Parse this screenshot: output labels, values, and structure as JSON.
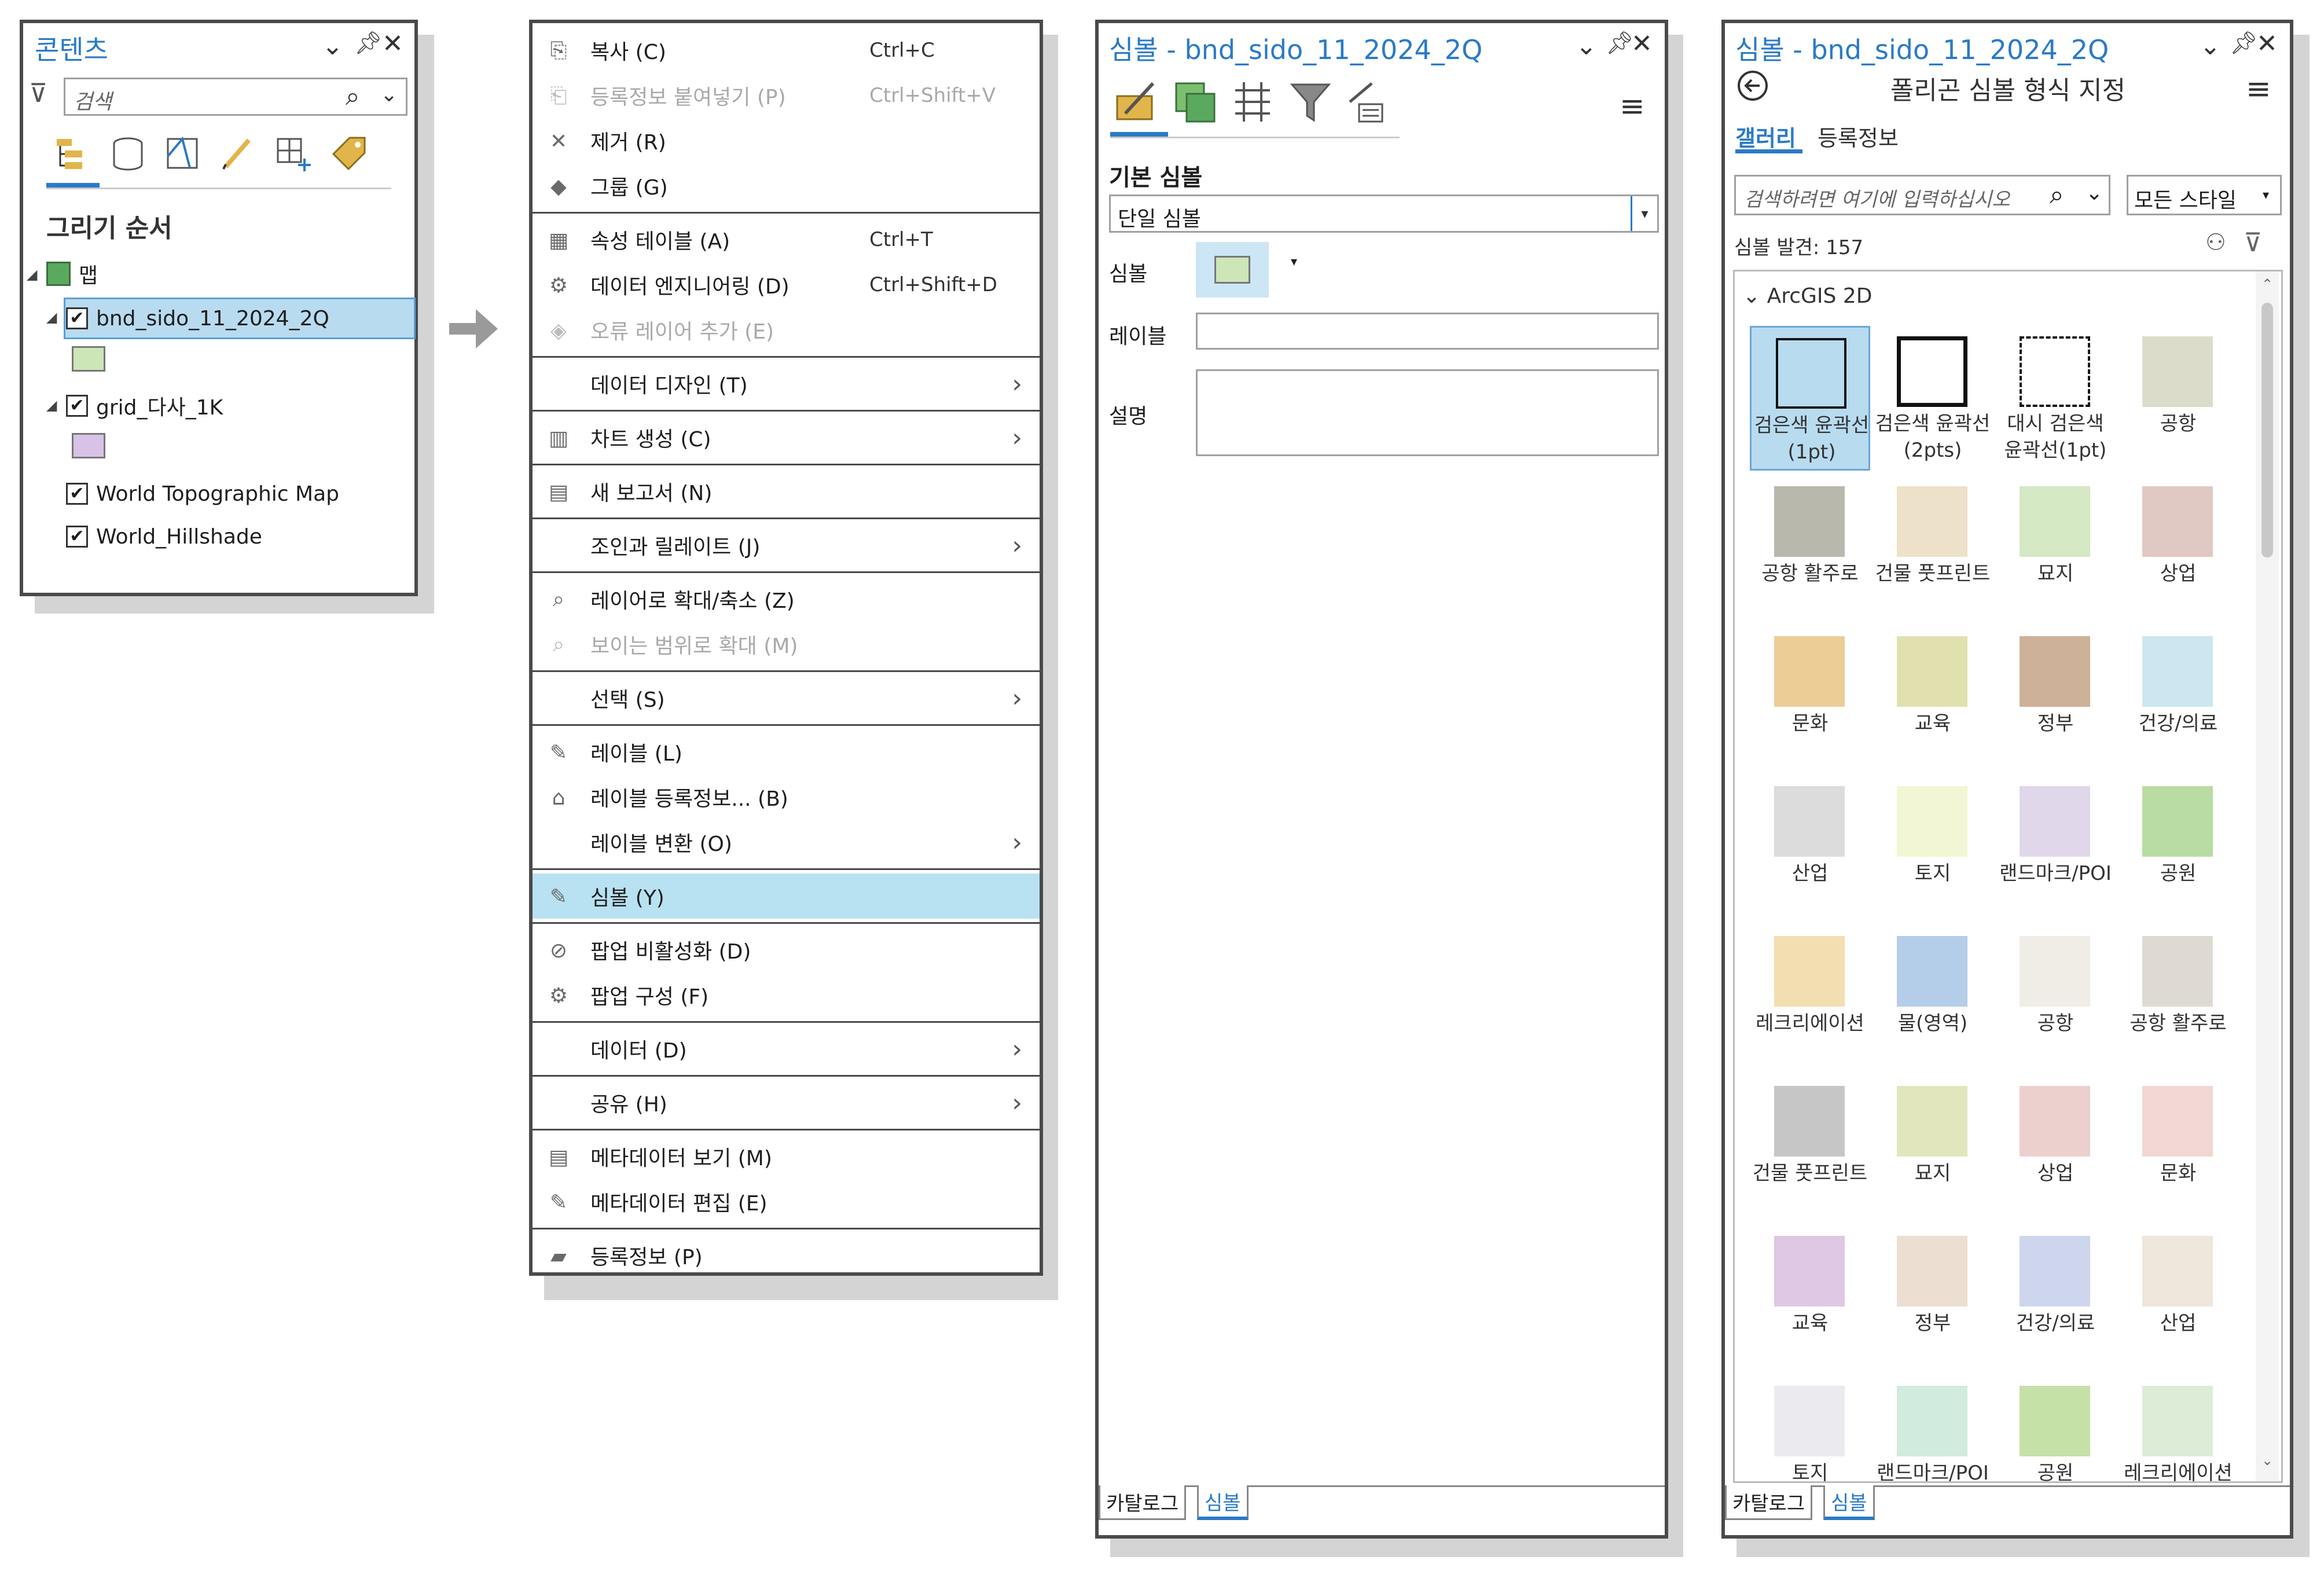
{
  "contents": {
    "title": "콘텐츠",
    "search_placeholder": "검색",
    "section_title": "그리기 순서",
    "map_label": "맵",
    "layers": [
      {
        "name": "bnd_sido_11_2024_2Q",
        "swatch": "#cce6b8"
      },
      {
        "name": "grid_다사_1K",
        "swatch": "#d8c2e8"
      }
    ],
    "basemaps": [
      "World Topographic Map",
      "World_Hillshade"
    ]
  },
  "context_menu": {
    "items": [
      {
        "label": "복사 (C)",
        "shortcut": "Ctrl+C",
        "icon": "copy-icon",
        "glyph": "⎘"
      },
      {
        "label": "등록정보 붙여넣기 (P)",
        "shortcut": "Ctrl+Shift+V",
        "icon": "paste-properties-icon",
        "glyph": "⎗",
        "disabled": true
      },
      {
        "label": "제거 (R)",
        "icon": "remove-icon",
        "glyph": "✕"
      },
      {
        "label": "그룹 (G)",
        "icon": "group-icon",
        "glyph": "◆"
      },
      {
        "label": "속성 테이블 (A)",
        "shortcut": "Ctrl+T",
        "icon": "attribute-table-icon",
        "glyph": "▦"
      },
      {
        "label": "데이터 엔지니어링 (D)",
        "shortcut": "Ctrl+Shift+D",
        "icon": "data-engineering-icon",
        "glyph": "⚙"
      },
      {
        "label": "오류 레이어 추가 (E)",
        "icon": "error-layer-icon",
        "glyph": "◈",
        "disabled": true
      },
      {
        "label": "데이터 디자인 (T)",
        "submenu": true
      },
      {
        "label": "차트 생성 (C)",
        "icon": "chart-icon",
        "glyph": "▥",
        "submenu": true
      },
      {
        "label": "새 보고서 (N)",
        "icon": "report-icon",
        "glyph": "▤"
      },
      {
        "label": "조인과 릴레이트 (J)",
        "submenu": true
      },
      {
        "label": "레이어로 확대/축소 (Z)",
        "icon": "zoom-to-layer-icon",
        "glyph": "⌕"
      },
      {
        "label": "보이는 범위로 확대 (M)",
        "icon": "zoom-visible-icon",
        "glyph": "⌕",
        "disabled": true
      },
      {
        "label": "선택 (S)",
        "submenu": true
      },
      {
        "label": "레이블 (L)",
        "icon": "label-icon",
        "glyph": "✎"
      },
      {
        "label": "레이블 등록정보... (B)",
        "icon": "label-properties-icon",
        "glyph": "⌂"
      },
      {
        "label": "레이블 변환 (O)",
        "submenu": true
      },
      {
        "label": "심볼 (Y)",
        "icon": "symbology-icon",
        "glyph": "✎",
        "selected": true
      },
      {
        "label": "팝업 비활성화 (D)",
        "icon": "disable-popup-icon",
        "glyph": "⊘"
      },
      {
        "label": "팝업 구성 (F)",
        "icon": "configure-popup-icon",
        "glyph": "⚙"
      },
      {
        "label": "데이터 (D)",
        "submenu": true
      },
      {
        "label": "공유 (H)",
        "submenu": true
      },
      {
        "label": "메타데이터 보기 (M)",
        "icon": "view-metadata-icon",
        "glyph": "▤"
      },
      {
        "label": "메타데이터 편집 (E)",
        "icon": "edit-metadata-icon",
        "glyph": "✎"
      },
      {
        "label": "등록정보 (P)",
        "icon": "properties-icon",
        "glyph": "▰"
      }
    ]
  },
  "symbology": {
    "title": "심볼 - bnd_sido_11_2024_2Q",
    "primary_label": "기본 심볼",
    "method": "단일 심볼",
    "symbol_label": "심볼",
    "symbol_color": "#cce6b8",
    "label_label": "레이블",
    "description_label": "설명",
    "bottom_tabs": [
      "카탈로그",
      "심볼"
    ]
  },
  "format": {
    "title": "심볼 - bnd_sido_11_2024_2Q",
    "subtitle": "폴리곤 심볼 형식 지정",
    "tabs": [
      "갤러리",
      "등록정보"
    ],
    "search_placeholder": "검색하려면 여기에 입력하십시오",
    "style_select": "모든 스타일",
    "found": "심볼 발견: 157",
    "group": "ArcGIS 2D",
    "bottom_tabs": [
      "카탈로그",
      "심볼"
    ],
    "gallery": [
      {
        "name": "검은색 윤곽선(1pt)",
        "fill": "transparent",
        "stroke": "thin"
      },
      {
        "name": "검은색 윤곽선(2pts)",
        "fill": "transparent",
        "stroke": "thick"
      },
      {
        "name": "대시 검은색 윤곽선(1pt)",
        "fill": "transparent",
        "stroke": "dash"
      },
      {
        "name": "공항",
        "fill": "#dcdccb"
      },
      {
        "name": "공항 활주로",
        "fill": "#b8b8ad"
      },
      {
        "name": "건물 풋프린트",
        "fill": "#ede1c9"
      },
      {
        "name": "묘지",
        "fill": "#d3e8c3"
      },
      {
        "name": "상업",
        "fill": "#e1c9c3"
      },
      {
        "name": "문화",
        "fill": "#eccd95"
      },
      {
        "name": "교육",
        "fill": "#e0e1ae"
      },
      {
        "name": "정부",
        "fill": "#cdb198"
      },
      {
        "name": "건강/의료",
        "fill": "#cde6ef"
      },
      {
        "name": "산업",
        "fill": "#dcdcdc"
      },
      {
        "name": "토지",
        "fill": "#f2f6d5"
      },
      {
        "name": "랜드마크/POI",
        "fill": "#e1d7ea"
      },
      {
        "name": "공원",
        "fill": "#b9dca3"
      },
      {
        "name": "레크리에이션",
        "fill": "#f3deb1"
      },
      {
        "name": "물(영역)",
        "fill": "#b4cde9"
      },
      {
        "name": "공항",
        "fill": "#efede5"
      },
      {
        "name": "공항 활주로",
        "fill": "#dedad2"
      },
      {
        "name": "건물 풋프린트",
        "fill": "#c6c6c6"
      },
      {
        "name": "묘지",
        "fill": "#e2e6bd"
      },
      {
        "name": "상업",
        "fill": "#ecd0cd"
      },
      {
        "name": "문화",
        "fill": "#f1d6d3"
      },
      {
        "name": "교육",
        "fill": "#dec8e3"
      },
      {
        "name": "정부",
        "fill": "#ecdfd1"
      },
      {
        "name": "건강/의료",
        "fill": "#ced6ee"
      },
      {
        "name": "산업",
        "fill": "#efe6dc"
      },
      {
        "name": "토지",
        "fill": "#ebebef"
      },
      {
        "name": "랜드마크/POI",
        "fill": "#d1ebde"
      },
      {
        "name": "공원",
        "fill": "#c5e1a8"
      },
      {
        "name": "레크리에이션",
        "fill": "#dcecd6"
      }
    ]
  }
}
